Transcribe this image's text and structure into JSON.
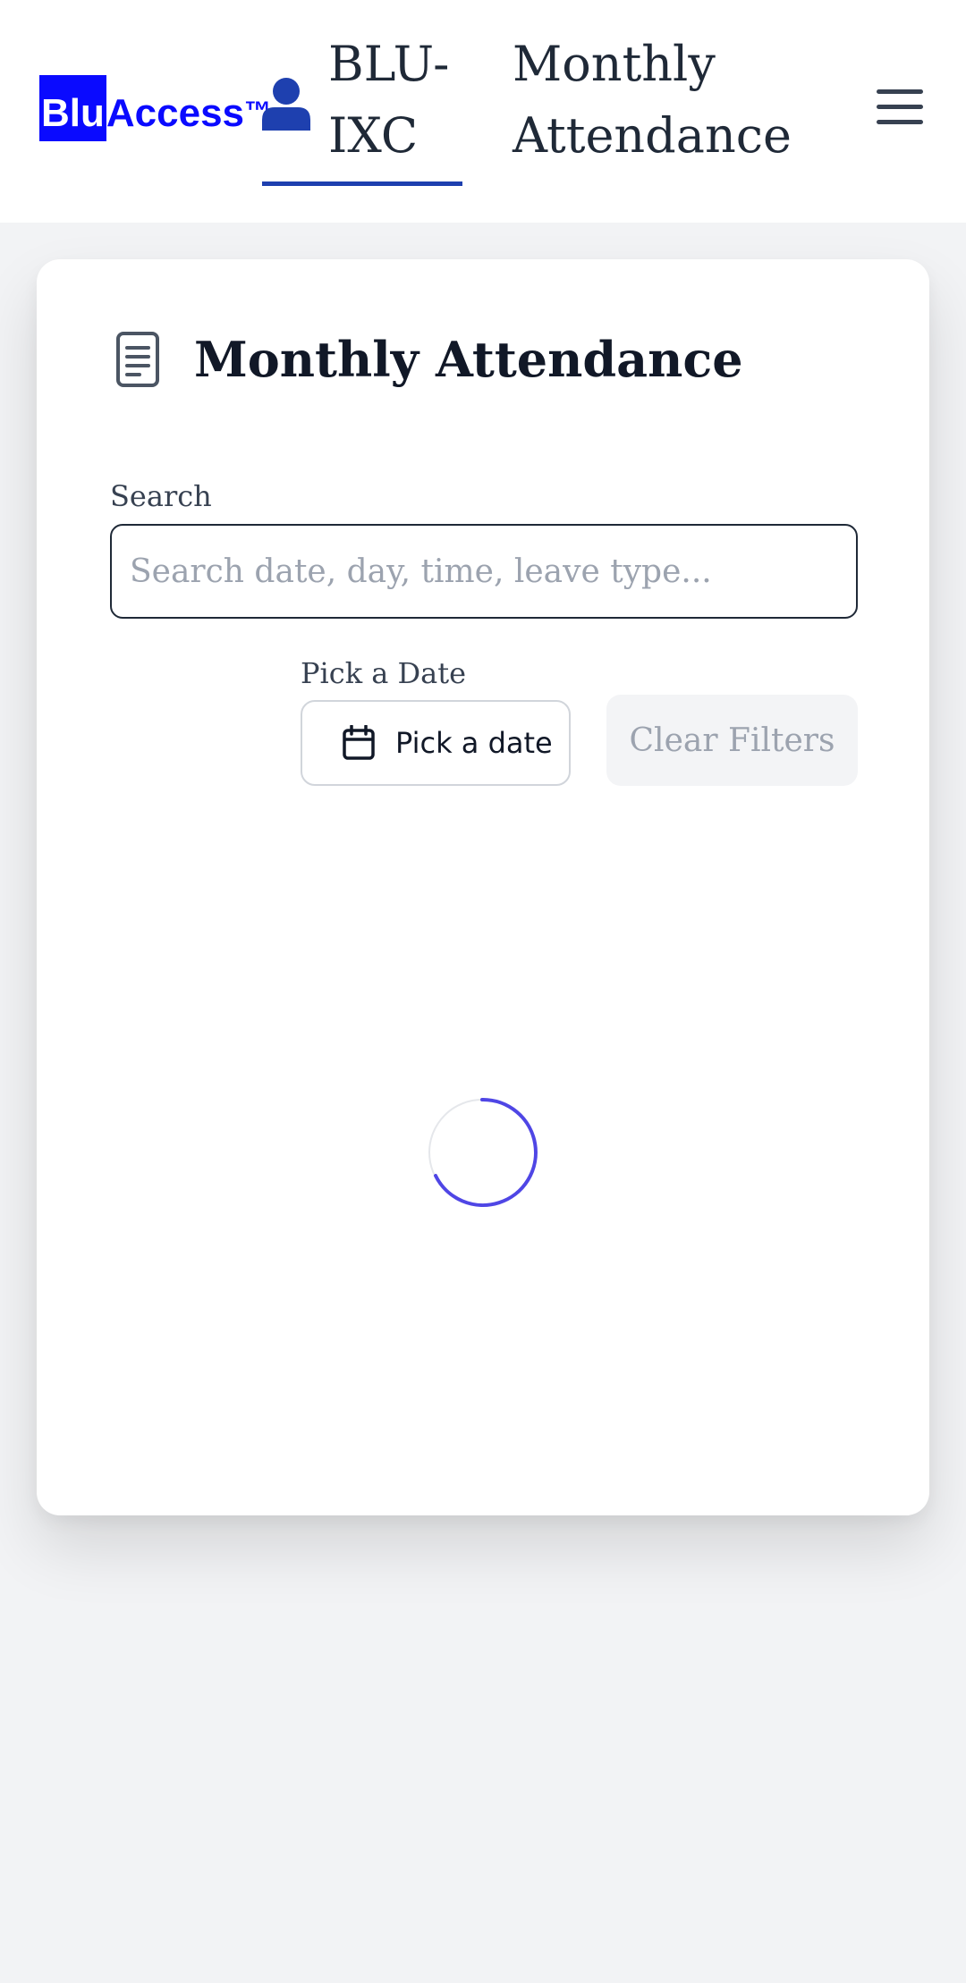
{
  "header": {
    "logo": {
      "box_text": "Blu",
      "rest_text": "Access",
      "tm": "™"
    },
    "nav_user_label": "BLU-IXC",
    "nav_title": "Monthly Attendance",
    "menu_icon": "hamburger-menu-icon"
  },
  "card": {
    "title": "Monthly Attendance",
    "title_icon": "document-icon",
    "search": {
      "label": "Search",
      "placeholder": "Search date, day, time, leave type...",
      "value": ""
    },
    "date_filter": {
      "label": "Pick a Date",
      "button_label": "Pick a date",
      "icon": "calendar-icon"
    },
    "clear_button_label": "Clear Filters",
    "loading_indicator": "spinner-icon"
  },
  "colors": {
    "brand": "#0a0aff",
    "accent": "#1e40af",
    "spinner": "#4f46e5",
    "background": "#f2f3f5"
  }
}
